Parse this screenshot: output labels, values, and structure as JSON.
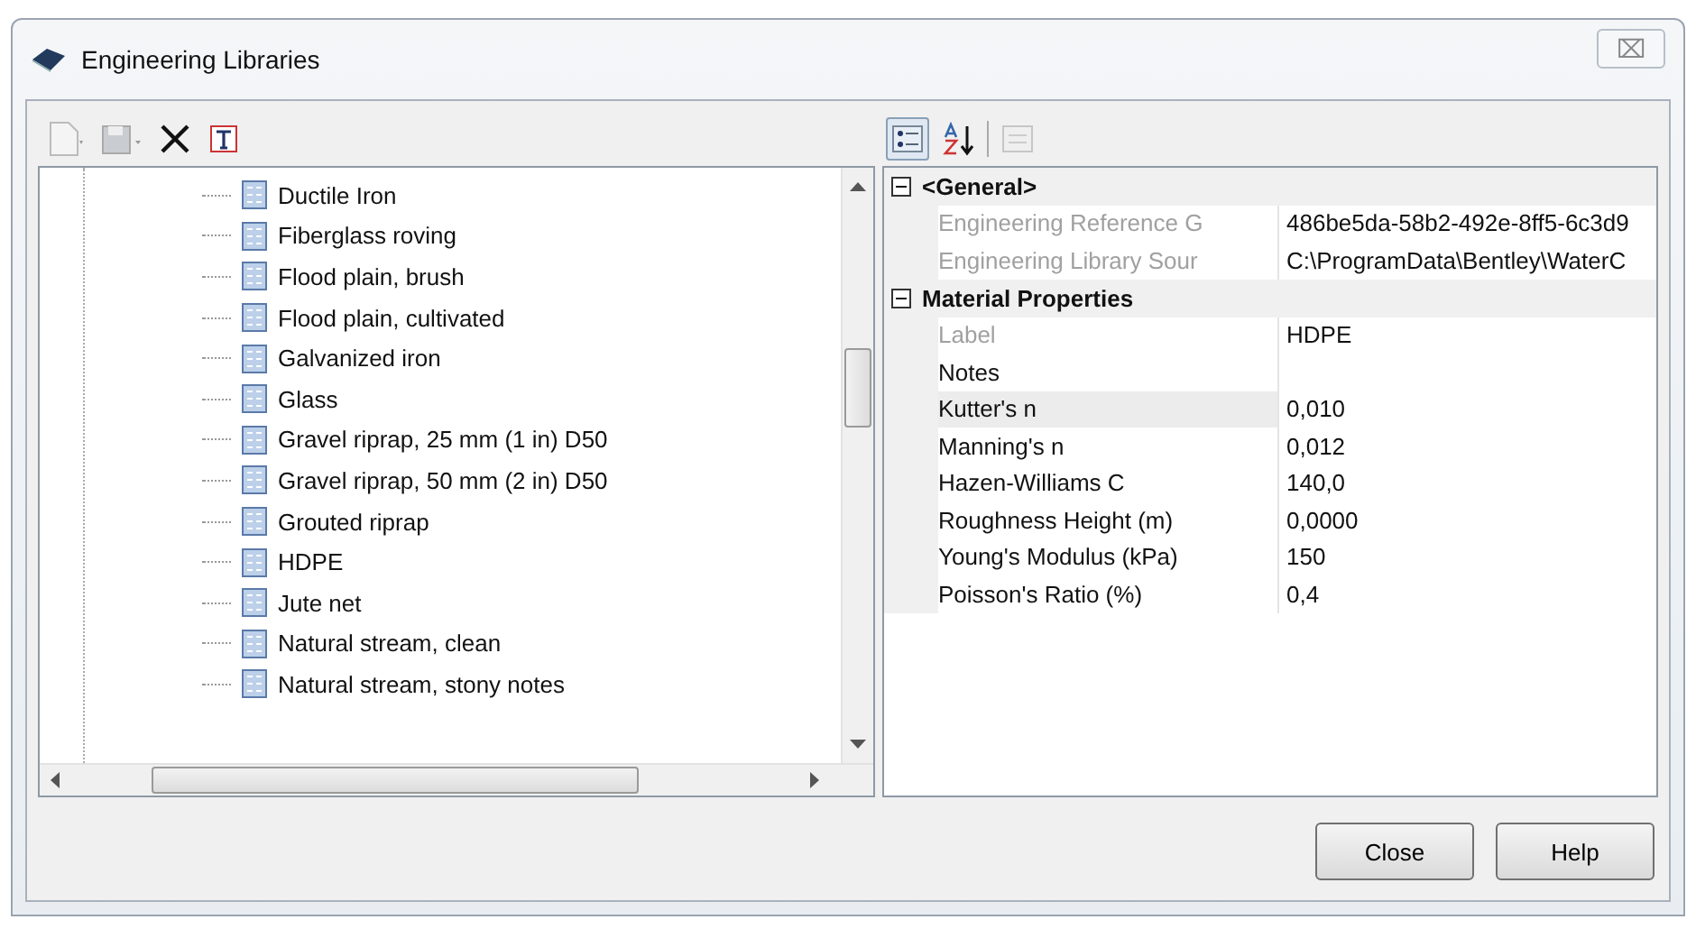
{
  "window": {
    "title": "Engineering Libraries",
    "close_symbol": "⌧"
  },
  "left_toolbar": [
    {
      "kind": "new"
    },
    {
      "kind": "save"
    },
    {
      "kind": "delete"
    },
    {
      "kind": "rename"
    }
  ],
  "tree": {
    "items": [
      {
        "label": "Ductile Iron"
      },
      {
        "label": "Fiberglass roving"
      },
      {
        "label": "Flood plain, brush"
      },
      {
        "label": "Flood plain, cultivated"
      },
      {
        "label": "Galvanized iron"
      },
      {
        "label": "Glass"
      },
      {
        "label": "Gravel riprap, 25 mm (1 in) D50"
      },
      {
        "label": "Gravel riprap, 50 mm (2 in) D50"
      },
      {
        "label": "Grouted riprap"
      },
      {
        "label": "HDPE"
      },
      {
        "label": "Jute net"
      },
      {
        "label": "Natural stream, clean"
      },
      {
        "label": "Natural stream, stony notes"
      }
    ]
  },
  "right_toolbar": [
    {
      "kind": "categorized",
      "selected": true,
      "disabled": false
    },
    {
      "kind": "alphabetical",
      "selected": false,
      "disabled": false
    },
    {
      "kind": "property-pages",
      "selected": false,
      "disabled": true
    }
  ],
  "property_grid": {
    "categories": [
      {
        "name": "<General>",
        "expanded": true,
        "properties": [
          {
            "name": "Engineering Reference G",
            "value": "486be5da-58b2-492e-8ff5-6c3d9",
            "disabled": true,
            "selected": false
          },
          {
            "name": "Engineering Library Sour",
            "value": "C:\\ProgramData\\Bentley\\WaterC",
            "disabled": true,
            "selected": false
          }
        ]
      },
      {
        "name": "Material Properties",
        "expanded": true,
        "properties": [
          {
            "name": "Label",
            "value": "HDPE",
            "disabled": true,
            "selected": false
          },
          {
            "name": "Notes",
            "disabled": false,
            "selected": false
          },
          {
            "name": "Kutter's n",
            "value": "0,010",
            "disabled": false,
            "selected": true
          },
          {
            "name": "Manning's n",
            "value": "0,012",
            "disabled": false,
            "selected": false
          },
          {
            "name": "Hazen-Williams C",
            "value": "140,0",
            "disabled": false,
            "selected": false
          },
          {
            "name": "Roughness Height (m)",
            "value": "0,0000",
            "disabled": false,
            "selected": false
          },
          {
            "name": "Young's Modulus (kPa)",
            "value": "150",
            "disabled": false,
            "selected": false
          },
          {
            "name": "Poisson's Ratio (%)",
            "value": "0,4",
            "disabled": false,
            "selected": false
          }
        ]
      }
    ]
  },
  "buttons": [
    {
      "label": "Close"
    },
    {
      "label": "Help"
    }
  ]
}
